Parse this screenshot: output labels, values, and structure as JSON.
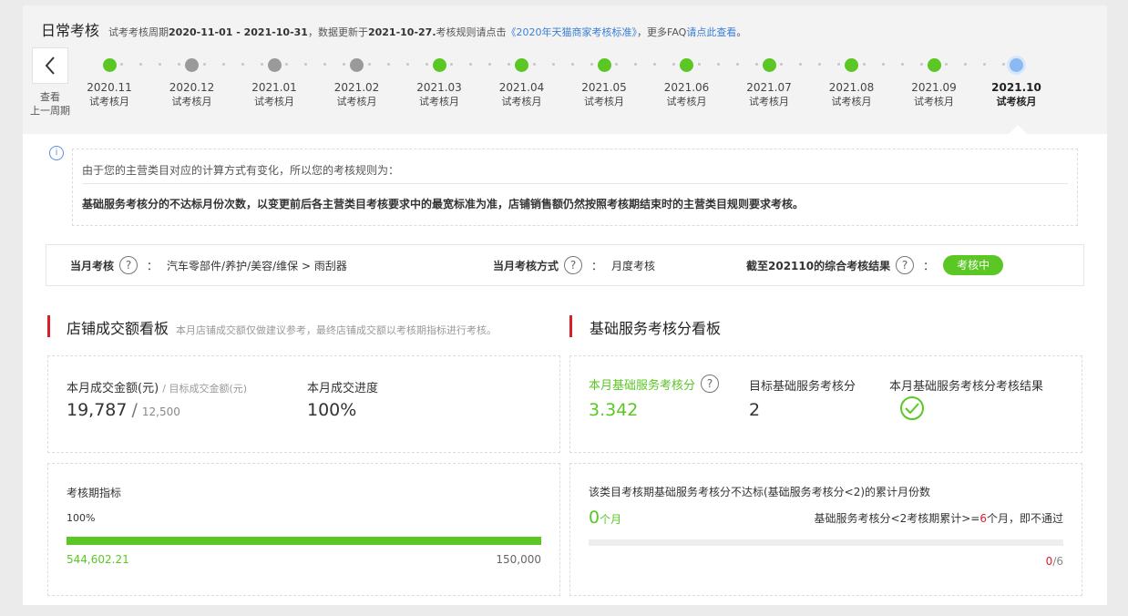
{
  "header": {
    "title": "日常考核",
    "subtitle": {
      "prefix": "试考考核周期",
      "period": "2020-11-01 - 2021-10-31",
      "mid": "，数据更新于",
      "updated": "2021-10-27.",
      "rule_text": "考核规则请点击",
      "rule_link": "《2020年天猫商家考核标准》",
      "faq_text": "，更多FAQ",
      "faq_link": "请点此查看",
      "end": "。"
    }
  },
  "back_button": {
    "label_line1": "查看",
    "label_line2": "上一周期"
  },
  "timeline": [
    {
      "month": "2020.11",
      "label": "试考核月",
      "status": "green"
    },
    {
      "month": "2020.12",
      "label": "试考核月",
      "status": "gray"
    },
    {
      "month": "2021.01",
      "label": "试考核月",
      "status": "gray"
    },
    {
      "month": "2021.02",
      "label": "试考核月",
      "status": "gray"
    },
    {
      "month": "2021.03",
      "label": "试考核月",
      "status": "green"
    },
    {
      "month": "2021.04",
      "label": "试考核月",
      "status": "green"
    },
    {
      "month": "2021.05",
      "label": "试考核月",
      "status": "green"
    },
    {
      "month": "2021.06",
      "label": "试考核月",
      "status": "green"
    },
    {
      "month": "2021.07",
      "label": "试考核月",
      "status": "green"
    },
    {
      "month": "2021.08",
      "label": "试考核月",
      "status": "green"
    },
    {
      "month": "2021.09",
      "label": "试考核月",
      "status": "green"
    },
    {
      "month": "2021.10",
      "label": "试考核月",
      "status": "current"
    }
  ],
  "notice": {
    "line1": "由于您的主营类目对应的计算方式有变化，所以您的考核规则为：",
    "line2": "基础服务考核分的不达标月份次数，以变更前后各主营类目考核要求中的最宽标准为准，店铺销售额仍然按照考核期结束时的主营类目规则要求考核。"
  },
  "summary": {
    "category_label": "当月考核",
    "category_value": "汽车零部件/养护/美容/维保 > 雨刮器",
    "method_label": "当月考核方式",
    "method_value": "月度考核",
    "result_label": "截至202110的综合考核结果",
    "result_value": "考核中",
    "colon": "：",
    "question": "?"
  },
  "sales_board": {
    "title": "店铺成交额看板",
    "note": "本月店铺成交额仅做建议参考，最终店铺成交额以考核期指标进行考核。",
    "amount_label": "本月成交金额(元)",
    "target_label": "/ 目标成交金额(元)",
    "amount": "19,787",
    "slash": "/",
    "target": "12,500",
    "progress_label": "本月成交进度",
    "progress": "100%",
    "period_label": "考核期指标",
    "period_percent": "100%",
    "period_progress_fraction": 1.0,
    "period_actual": "544,602.21",
    "period_target": "150,000"
  },
  "service_board": {
    "title": "基础服务考核分看板",
    "score_label": "本月基础服务考核分",
    "score": "3.342",
    "target_label": "目标基础服务考核分",
    "target": "2",
    "result_label": "本月基础服务考核分考核结果",
    "fail_title": "该类目考核期基础服务考核分不达标(基础服务考核分<2)的累计月份数",
    "fail_count": "0",
    "fail_unit": "个月",
    "rule_prefix": "基础服务考核分<2考核期累计>=",
    "rule_limit": "6",
    "rule_suffix": "个月，即不通过",
    "counter_current": "0",
    "counter_total": "/6",
    "counter_fraction": 0
  },
  "colors": {
    "accent_green": "#5ac724",
    "gray_dot": "#9a9a9a",
    "current_blue": "#8bb9f2",
    "section_red": "#d8202c",
    "link_blue": "#3a7fd5",
    "warn_red": "#d8202c"
  },
  "icons": {
    "back": "chevron-left-icon",
    "info": "info-icon",
    "question": "question-circle-icon",
    "check": "check-circle-icon"
  }
}
